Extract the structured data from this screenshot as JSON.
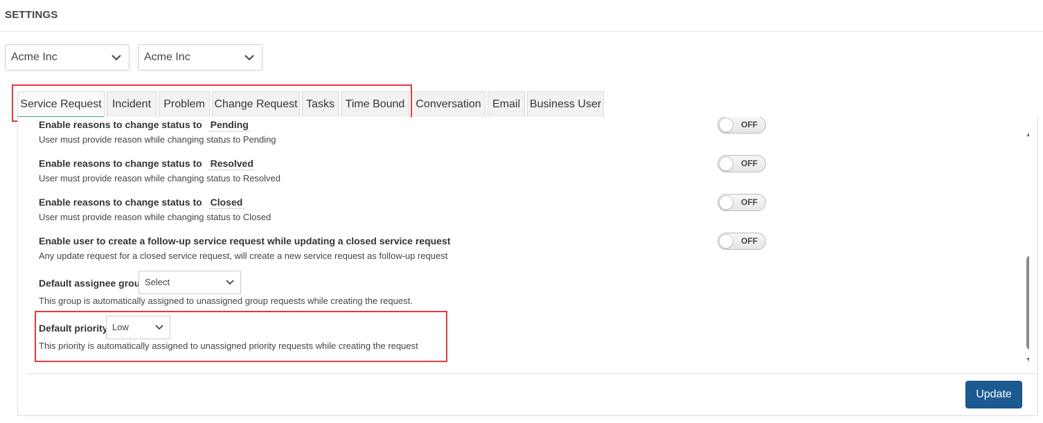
{
  "header": {
    "title": "SETTINGS"
  },
  "filters": [
    {
      "value": "Acme Inc"
    },
    {
      "value": "Acme Inc"
    }
  ],
  "tabs": [
    {
      "label": "Service Request",
      "active": true
    },
    {
      "label": "Incident"
    },
    {
      "label": "Problem"
    },
    {
      "label": "Change Request"
    },
    {
      "label": "Tasks"
    },
    {
      "label": "Time Bound"
    },
    {
      "label": "Conversation"
    },
    {
      "label": "Email"
    },
    {
      "label": "Business User"
    }
  ],
  "settings": {
    "pending": {
      "title": "Enable reasons to change status to",
      "status": "Pending",
      "desc": "User must provide reason while changing status to Pending",
      "toggle": "OFF"
    },
    "resolved": {
      "title": "Enable reasons to change status to",
      "status": "Resolved",
      "desc": "User must provide reason while changing status to Resolved",
      "toggle": "OFF"
    },
    "closed": {
      "title": "Enable reasons to change status to",
      "status": "Closed",
      "desc": "User must provide reason while changing status to Closed",
      "toggle": "OFF"
    },
    "followup": {
      "title": "Enable user to create a follow-up service request while updating a closed service request",
      "desc": "Any update request for a closed service request, will create a new service request as follow-up request",
      "toggle": "OFF"
    },
    "assignee_group": {
      "label": "Default assignee group",
      "value": "Select",
      "desc": "This group is automatically assigned to unassigned group requests while creating the request."
    },
    "priority": {
      "label": "Default priority",
      "value": "Low",
      "desc": "This priority is automatically assigned to unassigned priority requests while creating the request"
    }
  },
  "actions": {
    "update_label": "Update"
  },
  "colors": {
    "accent": "#1c5a92",
    "highlight": "#e0393e",
    "active_tab_underline": "#3fae6b"
  }
}
